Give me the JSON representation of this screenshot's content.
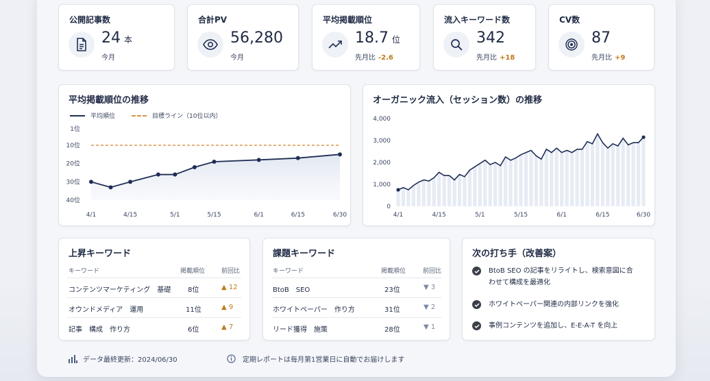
{
  "kpis": [
    {
      "title": "公開記事数",
      "value": "24",
      "unit": "本",
      "sub": "今月",
      "delta": "",
      "icon": "document-icon"
    },
    {
      "title": "合計PV",
      "value": "56,280",
      "unit": "",
      "sub": "今月",
      "delta": "",
      "icon": "eye-icon"
    },
    {
      "title": "平均掲載順位",
      "value": "18.7",
      "unit": "位",
      "sub": "先月比",
      "delta": "-2.6",
      "icon": "trend-up-icon"
    },
    {
      "title": "流入キーワード数",
      "value": "342",
      "unit": "",
      "sub": "先月比",
      "delta": "+18",
      "icon": "search-icon"
    },
    {
      "title": "CV数",
      "value": "87",
      "unit": "",
      "sub": "先月比",
      "delta": "+9",
      "icon": "target-icon"
    }
  ],
  "rank_chart": {
    "title": "平均掲載順位の推移",
    "legend_series": "平均順位",
    "legend_target": "目標ライン（10位以内）"
  },
  "traffic_chart": {
    "title": "オーガニック流入（セッション数）の推移"
  },
  "chart_data": [
    {
      "type": "line",
      "title": "平均掲載順位の推移",
      "x_ticks": [
        "4/1",
        "4/15",
        "5/1",
        "5/15",
        "6/1",
        "6/15",
        "6/30"
      ],
      "y_ticks": [
        "1位",
        "10位",
        "20位",
        "30位",
        "40位"
      ],
      "ylim": [
        1,
        40
      ],
      "y_inverted": true,
      "series": [
        {
          "name": "平均順位",
          "x": [
            "4/1",
            "4/8",
            "4/15",
            "4/25",
            "5/1",
            "5/8",
            "5/15",
            "6/1",
            "6/15",
            "6/30"
          ],
          "values": [
            30,
            33,
            30,
            26,
            26,
            22,
            19,
            18,
            17,
            15
          ]
        }
      ],
      "target": {
        "name": "目標ライン（10位以内）",
        "value": 10
      }
    },
    {
      "type": "area",
      "title": "オーガニック流入（セッション数）の推移",
      "x_ticks": [
        "4/1",
        "4/15",
        "5/1",
        "5/15",
        "6/1",
        "6/15",
        "6/30"
      ],
      "y_ticks": [
        "0",
        "1,000",
        "2,000",
        "3,000",
        "4,000"
      ],
      "ylim": [
        0,
        4000
      ],
      "values": [
        750,
        850,
        750,
        950,
        1100,
        1200,
        1150,
        1300,
        1550,
        1400,
        1400,
        1200,
        1450,
        1350,
        1650,
        1800,
        1950,
        2100,
        1900,
        2000,
        1850,
        2250,
        2100,
        2200,
        2350,
        2450,
        2550,
        2300,
        2150,
        2600,
        2450,
        2650,
        2450,
        2550,
        2450,
        2600,
        2600,
        2950,
        2850,
        3300,
        2900,
        2650,
        2850,
        2750,
        3100,
        2800,
        2900,
        2900,
        3150
      ]
    }
  ],
  "rising": {
    "title": "上昇キーワード",
    "headers": [
      "キーワード",
      "掲載順位",
      "前回比"
    ],
    "rows": [
      {
        "kw": "コンテンツマーケティング　基礎",
        "rank": "8位",
        "change": "▲ 12"
      },
      {
        "kw": "オウンドメディア　運用",
        "rank": "11位",
        "change": "▲ 9"
      },
      {
        "kw": "記事　構成　作り方",
        "rank": "6位",
        "change": "▲ 7"
      }
    ]
  },
  "issues": {
    "title": "課題キーワード",
    "headers": [
      "キーワード",
      "掲載順位",
      "前回比"
    ],
    "rows": [
      {
        "kw": "BtoB　SEO",
        "rank": "23位",
        "change": "▼ 3"
      },
      {
        "kw": "ホワイトペーパー　作り方",
        "rank": "31位",
        "change": "▼ 2"
      },
      {
        "kw": "リード獲得　施策",
        "rank": "28位",
        "change": "▼ 1"
      }
    ]
  },
  "actions": {
    "title": "次の打ち手（改善案）",
    "items": [
      "BtoB SEO の記事をリライトし、検索意図に合わせて構成を最適化",
      "ホワイトペーパー関連の内部リンクを強化",
      "事例コンテンツを追加し、E-E-A-T を向上"
    ]
  },
  "footer": {
    "updated": "データ最終更新：2024/06/30",
    "note": "定期レポートは毎月第1営業日に自動でお届けします"
  }
}
